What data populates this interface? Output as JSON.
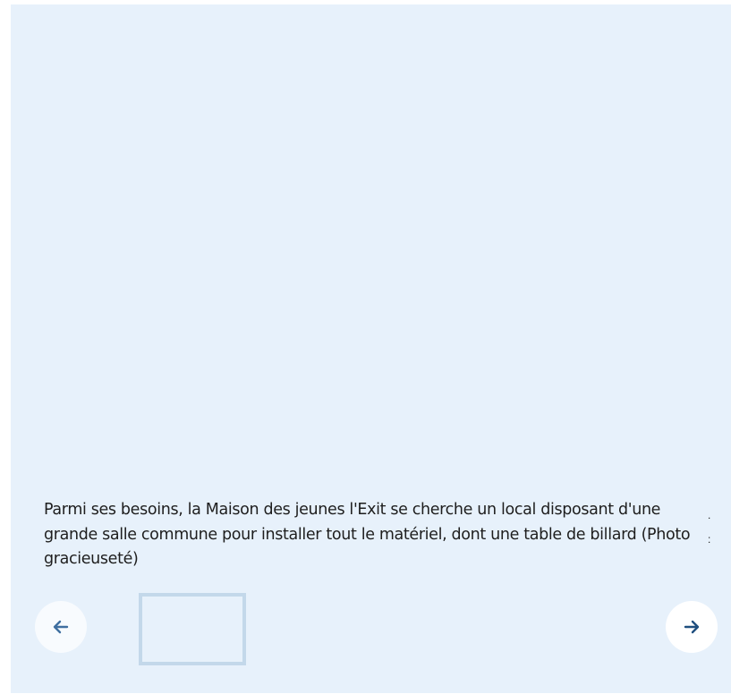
{
  "caption": {
    "text": "Parmi ses besoins, la Maison des jeunes l'Exit se cherche un local disposant d'une grande salle commune pour installer tout le matériel, dont une table de billard (Photo gracieuseté)"
  },
  "navigation": {
    "prev_icon": "arrow-left-icon",
    "next_icon": "arrow-right-icon"
  },
  "thumbnails": [
    {
      "selected": true
    }
  ],
  "colors": {
    "gallery_background": "#e7f1fb",
    "thumbnail_border": "#c3d8ea",
    "arrow_prev": "#3f6fa0",
    "arrow_next": "#1f4f7f",
    "caption_text": "#1e1e1e"
  }
}
